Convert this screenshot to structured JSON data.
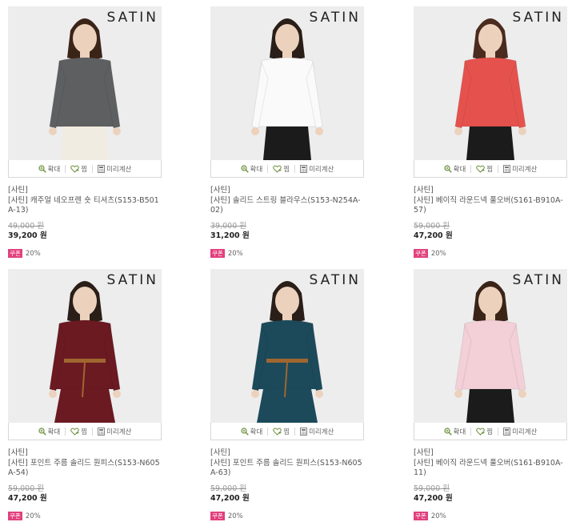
{
  "labels": {
    "zoom": "확대",
    "wish": "찜",
    "calc": "미리계산",
    "logo": "SATIN",
    "coupon": "쿠폰"
  },
  "products": [
    {
      "brand": "[사틴]",
      "name": "[사틴] 캐주얼 네오프렌 숏 티셔츠(S153-B501A-13)",
      "original_price": "49,000 원",
      "price": "39,200 원",
      "discount": "20%",
      "colors": {
        "top": "#5e5f61",
        "bottom": "#f1ece1",
        "hair": "#3a2418",
        "skin": "#ecd2bd"
      }
    },
    {
      "brand": "[사틴]",
      "name": "[사틴] 솔리드 스트링 블라우스(S153-N254A-02)",
      "original_price": "39,000 원",
      "price": "31,200 원",
      "discount": "20%",
      "colors": {
        "top": "#fafafa",
        "bottom": "#1b1b1b",
        "hair": "#2a1e18",
        "skin": "#ecd2bd"
      }
    },
    {
      "brand": "[사틴]",
      "name": "[사틴] 베이직 라운드넥 풀오버(S161-B910A-57)",
      "original_price": "59,000 원",
      "price": "47,200 원",
      "discount": "20%",
      "colors": {
        "top": "#e5524d",
        "bottom": "#1b1b1b",
        "hair": "#4a2b1e",
        "skin": "#ecd2bd"
      }
    },
    {
      "brand": "[사틴]",
      "name": "[사틴] 포인트 주름 솔리드 원피스(S153-N605A-54)",
      "original_price": "59,000 원",
      "price": "47,200 원",
      "discount": "20%",
      "colors": {
        "top": "#6b1a22",
        "bottom": "#6b1a22",
        "hair": "#2a1e18",
        "skin": "#ecd2bd"
      }
    },
    {
      "brand": "[사틴]",
      "name": "[사틴] 포인트 주름 솔리드 원피스(S153-N605A-63)",
      "original_price": "59,000 원",
      "price": "47,200 원",
      "discount": "20%",
      "colors": {
        "top": "#1c4a5a",
        "bottom": "#1c4a5a",
        "hair": "#2a1e18",
        "skin": "#ecd2bd"
      }
    },
    {
      "brand": "[사틴]",
      "name": "[사틴] 베이직 라운드넥 풀오버(S161-B910A-11)",
      "original_price": "59,000 원",
      "price": "47,200 원",
      "discount": "20%",
      "colors": {
        "top": "#f3cfd8",
        "bottom": "#1b1b1b",
        "hair": "#3a2418",
        "skin": "#ecd2bd"
      }
    }
  ]
}
